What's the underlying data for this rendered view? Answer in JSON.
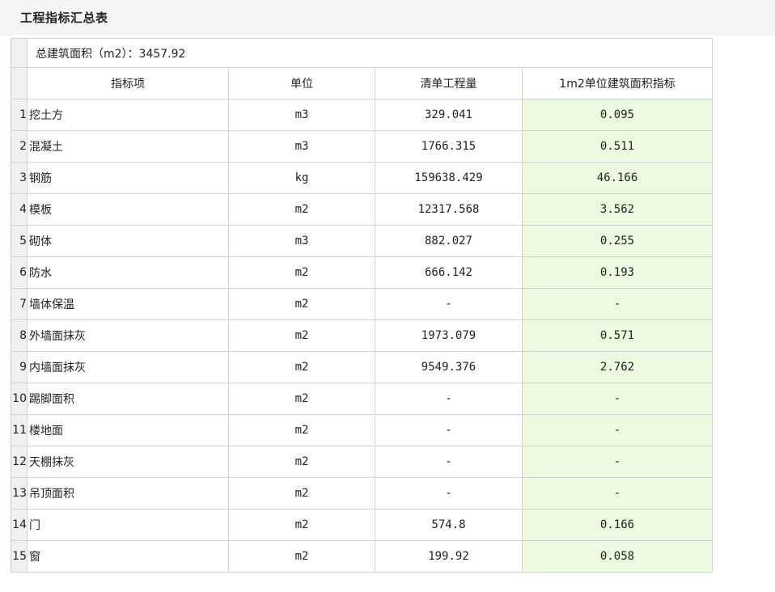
{
  "page": {
    "title": "工程指标汇总表"
  },
  "table": {
    "summary": "总建筑面积（m2）：3457.92",
    "headers": [
      "指标项",
      "单位",
      "清单工程量",
      "1m2单位建筑面积指标"
    ],
    "rows": [
      {
        "num": "1",
        "name": "挖土方",
        "unit": "m3",
        "qty": "329.041",
        "index": "0.095"
      },
      {
        "num": "2",
        "name": "混凝土",
        "unit": "m3",
        "qty": "1766.315",
        "index": "0.511"
      },
      {
        "num": "3",
        "name": "钢筋",
        "unit": "kg",
        "qty": "159638.429",
        "index": "46.166"
      },
      {
        "num": "4",
        "name": "模板",
        "unit": "m2",
        "qty": "12317.568",
        "index": "3.562"
      },
      {
        "num": "5",
        "name": "砌体",
        "unit": "m3",
        "qty": "882.027",
        "index": "0.255"
      },
      {
        "num": "6",
        "name": "防水",
        "unit": "m2",
        "qty": "666.142",
        "index": "0.193"
      },
      {
        "num": "7",
        "name": "墙体保温",
        "unit": "m2",
        "qty": "-",
        "index": "-"
      },
      {
        "num": "8",
        "name": "外墙面抹灰",
        "unit": "m2",
        "qty": "1973.079",
        "index": "0.571"
      },
      {
        "num": "9",
        "name": "内墙面抹灰",
        "unit": "m2",
        "qty": "9549.376",
        "index": "2.762"
      },
      {
        "num": "10",
        "name": "踢脚面积",
        "unit": "m2",
        "qty": "-",
        "index": "-"
      },
      {
        "num": "11",
        "name": "楼地面",
        "unit": "m2",
        "qty": "-",
        "index": "-"
      },
      {
        "num": "12",
        "name": "天棚抹灰",
        "unit": "m2",
        "qty": "-",
        "index": "-"
      },
      {
        "num": "13",
        "name": "吊顶面积",
        "unit": "m2",
        "qty": "-",
        "index": "-"
      },
      {
        "num": "14",
        "name": "门",
        "unit": "m2",
        "qty": "574.8",
        "index": "0.166"
      },
      {
        "num": "15",
        "name": "窗",
        "unit": "m2",
        "qty": "199.92",
        "index": "0.058"
      }
    ]
  },
  "colors": {
    "index_column_bg": "#ebfadf",
    "title_bar_bg": "#f5f5f5",
    "row_number_bg": "#f0f0f0"
  }
}
